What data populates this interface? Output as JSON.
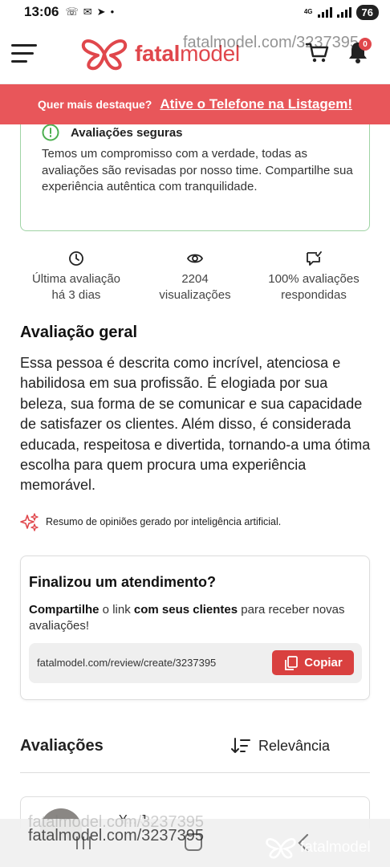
{
  "status_bar": {
    "time": "13:06",
    "network": "4G",
    "battery": "76"
  },
  "header": {
    "logo_bold": "fatal",
    "logo_regular": "model",
    "watermark": "fatalmodel.com/3237395",
    "notifications_count": "0"
  },
  "promo": {
    "text": "Quer mais destaque?",
    "link": "Ative o Telefone na Listagem!"
  },
  "safe_reviews": {
    "title": "Avaliações seguras",
    "body": "Temos um compromisso com a verdade, todas as avaliações são revisadas por nosso time. Compartilhe sua experiência autêntica com tranquilidade."
  },
  "stats": [
    {
      "icon": "clock-icon",
      "line1": "Última avaliação",
      "line2": "há 3 dias"
    },
    {
      "icon": "eye-icon",
      "line1": "2204",
      "line2": "visualizações"
    },
    {
      "icon": "chat-check-icon",
      "line1": "100% avaliações",
      "line2": "respondidas"
    }
  ],
  "overall": {
    "title": "Avaliação geral",
    "text": "Essa pessoa é descrita como incrível, atenciosa e habilidosa em sua profissão. É elogiada por sua beleza, sua forma de se comunicar e sua capacidade de satisfazer os clientes. Além disso, é considerada educada, respeitosa e divertida, tornando-a uma ótima escolha para quem procura uma experiência memorável.",
    "ai_note": "Resumo de opiniões gerado por inteligência artificial."
  },
  "finish_card": {
    "title": "Finalizou um atendimento?",
    "desc_bold_1": "Compartilhe",
    "desc_1": " o link ",
    "desc_bold_2": "com seus clientes",
    "desc_2": " para receber novas avaliações!",
    "link": "fatalmodel.com/review/create/3237395",
    "copy_label": "Copiar"
  },
  "reviews": {
    "title": "Avaliações",
    "sort_label": "Relevância",
    "first_reviewer_partial": "Y... J..."
  },
  "bottom_watermark": {
    "url": "fatalmodel.com/3237395",
    "logo": "fatalmodel"
  },
  "colors": {
    "brand_red": "#e0474c",
    "banner_red": "#e8565a",
    "safe_green": "#4caf50",
    "copy_button": "#d9403f"
  }
}
